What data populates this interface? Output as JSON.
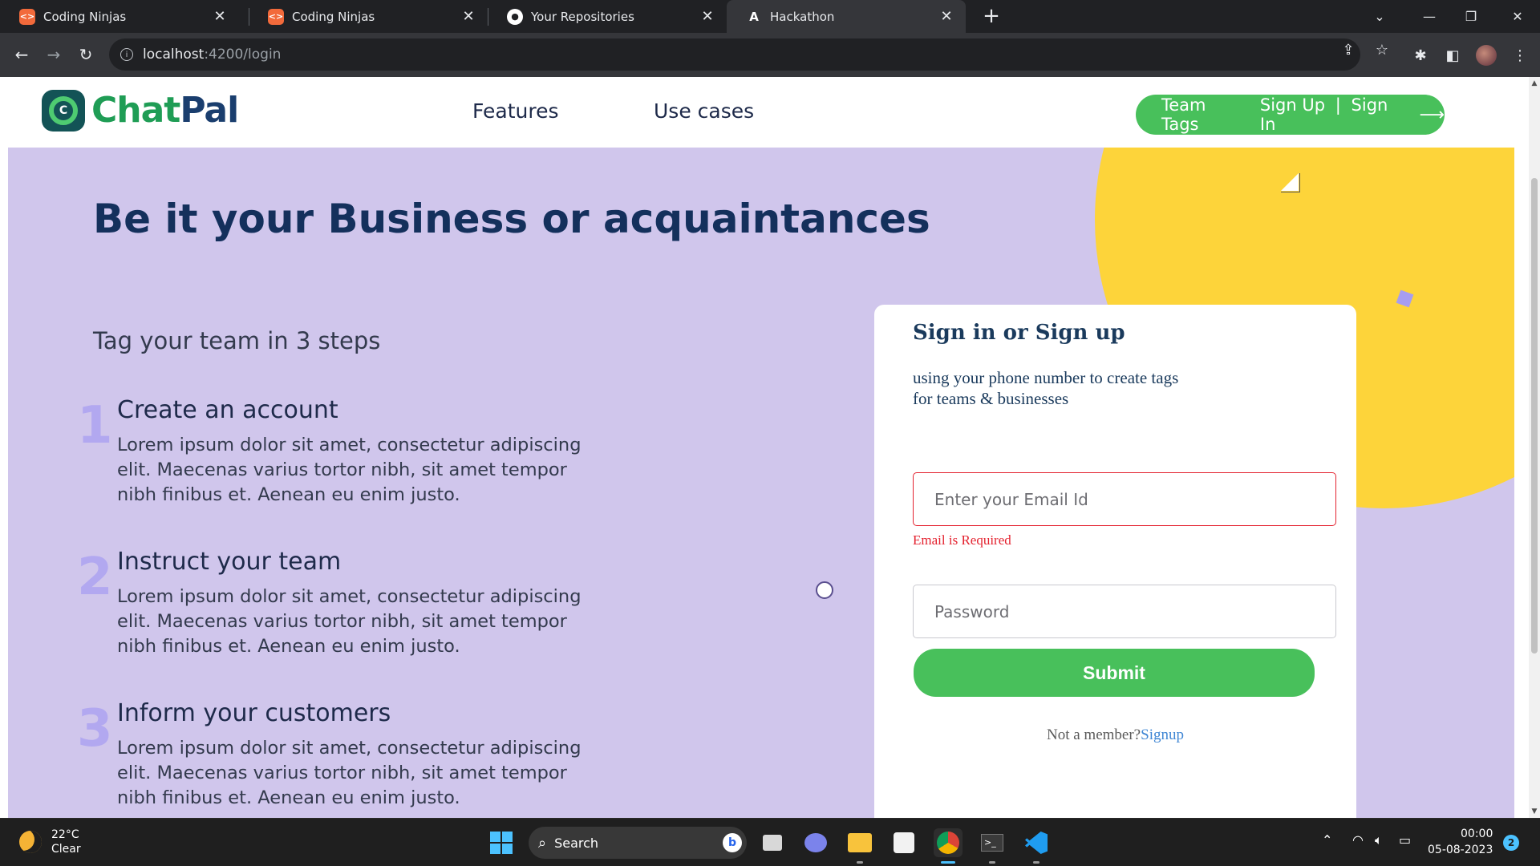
{
  "browser": {
    "tabs": [
      {
        "title": "Coding Ninjas",
        "icon": "coding-ninjas-icon"
      },
      {
        "title": "Coding Ninjas",
        "icon": "coding-ninjas-icon"
      },
      {
        "title": "Your Repositories",
        "icon": "github-icon"
      },
      {
        "title": "Hackathon",
        "icon": "angular-icon",
        "active": true
      }
    ],
    "url_host": "localhost",
    "url_path": ":4200/login"
  },
  "site": {
    "logo_chat": "Chat",
    "logo_pal": "Pal",
    "nav": [
      "Features",
      "Use cases"
    ],
    "cta": {
      "team_tags": "Team Tags",
      "signup": "Sign Up",
      "separator": "|",
      "signin": "Sign In"
    }
  },
  "hero": {
    "title": "Be it your Business or acquaintances",
    "steps_title": "Tag your team in 3 steps",
    "steps": [
      {
        "num": "1",
        "title": "Create an account",
        "text": "Lorem ipsum dolor sit amet, consectetur adipiscing elit. Maecenas varius tortor nibh, sit amet tempor nibh finibus et. Aenean eu enim justo."
      },
      {
        "num": "2",
        "title": "Instruct your team",
        "text": "Lorem ipsum dolor sit amet, consectetur adipiscing elit. Maecenas varius tortor nibh, sit amet tempor nibh finibus et. Aenean eu enim justo."
      },
      {
        "num": "3",
        "title": "Inform your customers",
        "text": "Lorem ipsum dolor sit amet, consectetur adipiscing elit. Maecenas varius tortor nibh, sit amet tempor nibh finibus et. Aenean eu enim justo."
      }
    ]
  },
  "form": {
    "title": "Sign in or Sign up",
    "subtitle_1": "using your phone number to create tags",
    "subtitle_2": "for teams & businesses",
    "email_placeholder": "Enter your Email Id",
    "email_error": "Email is Required",
    "password_placeholder": "Password",
    "submit": "Submit",
    "footer_text": "Not a member?",
    "footer_link": "Signup"
  },
  "taskbar": {
    "temperature": "22°C",
    "condition": "Clear",
    "search": "Search",
    "time": "00:00",
    "date": "05-08-2023",
    "notifications": "2"
  },
  "colors": {
    "accent_green": "#48c05b",
    "hero_bg": "#d0c6ec",
    "sun_yellow": "#fdd43a",
    "error_red": "#e4222f",
    "heading_navy": "#14305c"
  }
}
